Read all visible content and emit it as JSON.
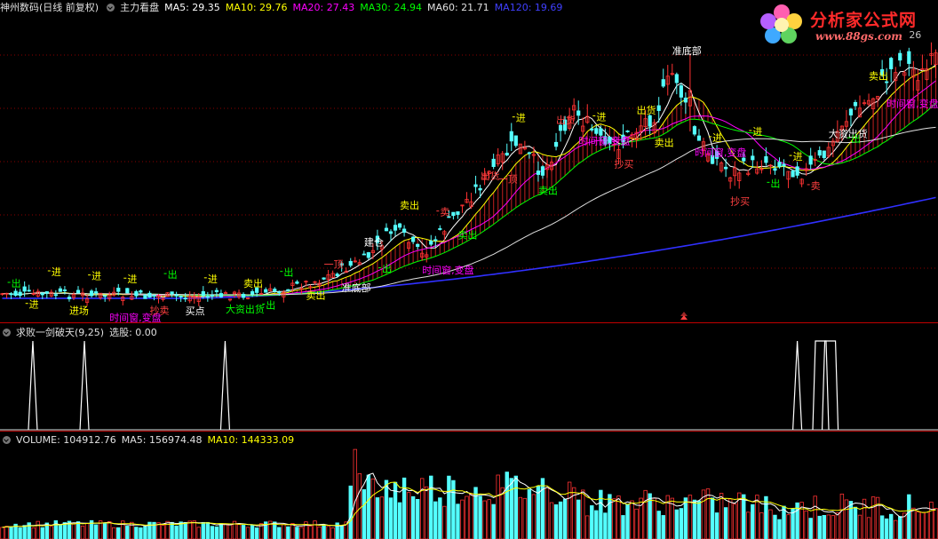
{
  "main_header": {
    "stock": "神州数码(日线 前复权)",
    "indicator_name": "主力看盘",
    "ma": [
      {
        "label": "MA5: 29.35",
        "color": "#ffffff"
      },
      {
        "label": "MA10: 29.76",
        "color": "#ffff00"
      },
      {
        "label": "MA20: 27.43",
        "color": "#ff00ff"
      },
      {
        "label": "MA30: 24.94",
        "color": "#00ff00"
      },
      {
        "label": "MA60: 21.71",
        "color": "#e0e0e0"
      },
      {
        "label": "MA120: 19.69",
        "color": "#4040ff"
      }
    ]
  },
  "sub_header": {
    "indicator": "求败一剑破天(9,25)",
    "value": "选股: 0.00"
  },
  "vol_header": {
    "volume": "VOLUME: 104912.76",
    "ma5": "MA5: 156974.48",
    "ma10": "MA10: 144333.09"
  },
  "logo": {
    "name": "分析家公式网",
    "url": "www.88gs.com"
  },
  "colors": {
    "bg": "#000000",
    "up": "#ff3232",
    "down": "#54ffff",
    "divider": "#c00000",
    "ma5": "#ffffff",
    "ma10": "#ffff00",
    "ma20": "#ff00ff",
    "ma30": "#00ff00",
    "ma60": "#e0e0e0",
    "ma120": "#3030ff"
  },
  "chart_data": [
    {
      "type": "candlestick",
      "annotations": [
        {
          "text": "出",
          "color": "#00ff00"
        },
        {
          "text": "进",
          "color": "#ffff00"
        },
        {
          "text": "进",
          "color": "#ffff00"
        },
        {
          "text": "进场",
          "color": "#ffff00"
        },
        {
          "text": "进",
          "color": "#ffff00"
        },
        {
          "text": "时间窗,变盘",
          "color": "#ff00ff"
        },
        {
          "text": "进",
          "color": "#ffff00"
        },
        {
          "text": "抄卖",
          "color": "#ff4040"
        },
        {
          "text": "出",
          "color": "#00ff00"
        },
        {
          "text": "买点",
          "color": "#ffffff"
        },
        {
          "text": "进",
          "color": "#ffff00"
        },
        {
          "text": "大资出货",
          "color": "#00ff00"
        },
        {
          "text": "卖出",
          "color": "#ffff00"
        },
        {
          "text": "出",
          "color": "#00ff00"
        },
        {
          "text": "出",
          "color": "#00ff00"
        },
        {
          "text": "卖出",
          "color": "#ffff00"
        },
        {
          "text": "一顶",
          "color": "#ff4040"
        },
        {
          "text": "准底部",
          "color": "#ffffff"
        },
        {
          "text": "建仓",
          "color": "#ffffff"
        },
        {
          "text": "出",
          "color": "#00ff00"
        },
        {
          "text": "卖出",
          "color": "#ffff00"
        },
        {
          "text": "时间窗,变盘",
          "color": "#ff00ff"
        },
        {
          "text": "卖",
          "color": "#ff4040"
        },
        {
          "text": "卖出",
          "color": "#00ff00"
        },
        {
          "text": "出货",
          "color": "#ff4040"
        },
        {
          "text": "一顶",
          "color": "#ff4040"
        },
        {
          "text": "进",
          "color": "#ffff00"
        },
        {
          "text": "卖出",
          "color": "#00ff00"
        },
        {
          "text": "出货",
          "color": "#ff4040"
        },
        {
          "text": "时间窗,变盘",
          "color": "#ff00ff"
        },
        {
          "text": "进",
          "color": "#ffff00"
        },
        {
          "text": "抄买",
          "color": "#ff4040"
        },
        {
          "text": "出货",
          "color": "#ffff00"
        },
        {
          "text": "卖出",
          "color": "#ffff00"
        },
        {
          "text": "准底部",
          "color": "#ffffff"
        },
        {
          "text": "时间窗,变盘",
          "color": "#ff00ff"
        },
        {
          "text": "进",
          "color": "#ffff00"
        },
        {
          "text": "抄买",
          "color": "#ff4040"
        },
        {
          "text": "进",
          "color": "#ffff00"
        },
        {
          "text": "出",
          "color": "#00ff00"
        },
        {
          "text": "进",
          "color": "#ffff00"
        },
        {
          "text": "卖",
          "color": "#ff4040"
        },
        {
          "text": "大资出货",
          "color": "#ffffff"
        },
        {
          "text": "出",
          "color": "#00ff00"
        },
        {
          "text": "卖出",
          "color": "#ffff00"
        },
        {
          "text": "时间窗,变盘",
          "color": "#ff00ff"
        },
        {
          "text": "26",
          "color": "#c0c0c0"
        }
      ]
    },
    {
      "type": "line",
      "name": "选股",
      "value": 0.0,
      "spikes": [
        0.035,
        0.09,
        0.24,
        0.85,
        0.875,
        0.885
      ]
    },
    {
      "type": "bar",
      "name": "VOLUME",
      "value": 104912.76,
      "ma5": 156974.48,
      "ma10": 144333.09
    }
  ]
}
